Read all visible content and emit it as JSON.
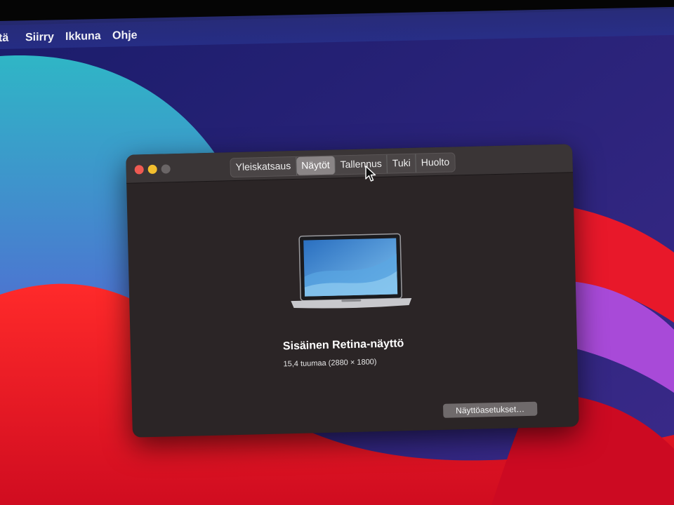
{
  "menubar": {
    "items": [
      {
        "label": "tä"
      },
      {
        "label": "Siirry"
      },
      {
        "label": "Ikkuna"
      },
      {
        "label": "Ohje"
      }
    ]
  },
  "window": {
    "tabs": [
      {
        "label": "Yleiskatsaus",
        "active": false
      },
      {
        "label": "Näytöt",
        "active": true
      },
      {
        "label": "Tallennus",
        "active": false
      },
      {
        "label": "Tuki",
        "active": false
      },
      {
        "label": "Huolto",
        "active": false
      }
    ],
    "display": {
      "name": "Sisäinen Retina-näyttö",
      "size": "15,4 tuumaa (2880 × 1800)",
      "icon": "macbook-pro-icon"
    },
    "settings_button": "Näyttöasetukset…"
  },
  "colors": {
    "close": "#ee5a52",
    "minimize": "#f2be2e",
    "window_bg": "#2b2526"
  }
}
